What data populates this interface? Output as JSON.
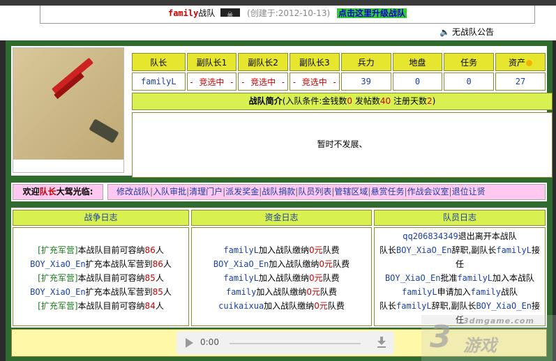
{
  "header": {
    "team_name": "family",
    "team_suffix": "战队",
    "created": "(创建于:2012-10-13)",
    "upgrade_link": "点击这里升级战队",
    "notice": "无战队公告"
  },
  "stats": {
    "headers": [
      "队长",
      "副队长1",
      "副队长2",
      "副队长3",
      "兵力",
      "地盘",
      "任务",
      "资产"
    ],
    "values": [
      "familyL",
      "- 竞选中 -",
      "- 竞选中 -",
      "- 竞选中 -",
      "39",
      "0",
      "0",
      "27"
    ]
  },
  "intro": {
    "title": "战队简介",
    "cond_prefix": "(入队条件:金钱数",
    "money": "0",
    "posts_label": " 发帖数",
    "posts": "40",
    "days_label": " 注册天数",
    "days": "2",
    "cond_suffix": ")",
    "body": "暂时不发展、"
  },
  "welcome": {
    "pre": "欢迎",
    "role": "队长",
    "post": "大驾光临:",
    "links": [
      "修改战队",
      "入队审批",
      "清理门户",
      "派发奖金",
      "战队捐款",
      "队员列表",
      "管辖区域",
      "悬赏任务",
      "作战会议室",
      "退位让贤"
    ]
  },
  "logs": {
    "war": {
      "title": "战争日志",
      "lines": [
        {
          "a": "[扩充军营]",
          "b": "本战队目前可容纳",
          "c": "86",
          "d": "人"
        },
        {
          "a": "BOY_XiaO_En",
          "b": "扩充本战队军营到",
          "c": "86",
          "d": "人"
        },
        {
          "a": "[扩充军营]",
          "b": "本战队目前可容纳",
          "c": "85",
          "d": "人"
        },
        {
          "a": "BOY_XiaO_En",
          "b": "扩充本战队军营到",
          "c": "85",
          "d": "人"
        },
        {
          "a": "[扩充军营]",
          "b": "本战队目前可容纳",
          "c": "84",
          "d": "人"
        }
      ]
    },
    "fund": {
      "title": "资金日志",
      "lines": [
        {
          "a": "familyL",
          "b": "加入战队缴纳",
          "c": "0元",
          "d": "队费"
        },
        {
          "a": "BOY_XiaO_En",
          "b": "加入战队缴纳",
          "c": "0元",
          "d": "队费"
        },
        {
          "a": "familyL",
          "b": "加入战队缴纳",
          "c": "0元",
          "d": "队费"
        },
        {
          "a": "family",
          "b": "加入战队缴纳",
          "c": "0元",
          "d": "队费"
        },
        {
          "a": "cuikaixua",
          "b": "加入战队缴纳",
          "c": "0元",
          "d": "队费"
        }
      ]
    },
    "member": {
      "title": "队员日志",
      "lines": [
        {
          "a": "qq206834349",
          "b": "退出离开本战队"
        },
        {
          "a": "队长",
          "u1": "BOY_XiaO_En",
          "b": "辞职,副队长",
          "u2": "familyL",
          "c": "接任"
        },
        {
          "a": "BOY_XiaO_En",
          "b": "批准",
          "u2": "familyL",
          "c": "加入本战队"
        },
        {
          "a": "familyL",
          "b": "申请加入",
          "u2": "family",
          "c": "战队"
        },
        {
          "a": "队长",
          "u1": "familyL",
          "b": "辞职,副队长",
          "u2": "BOY_XiaO_En",
          "c": "接任"
        }
      ]
    }
  },
  "player": {
    "time": "0:00"
  },
  "watermark": {
    "site": "3dmgame.com",
    "num": "3",
    "brand": "游戏"
  }
}
